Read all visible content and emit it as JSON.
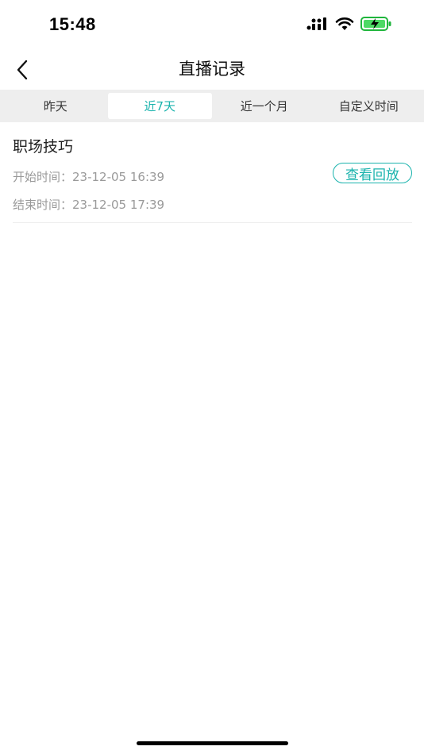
{
  "status_bar": {
    "time": "15:48"
  },
  "nav": {
    "title": "直播记录",
    "back_icon": "chevron-left-icon"
  },
  "tabs": [
    {
      "label": "昨天",
      "active": false
    },
    {
      "label": "近7天",
      "active": true
    },
    {
      "label": "近一个月",
      "active": false
    },
    {
      "label": "自定义时间",
      "active": false
    }
  ],
  "records": [
    {
      "title": "职场技巧",
      "start": "开始时间：23-12-05 16:39",
      "end": "结束时间：23-12-05 17:39",
      "replay_label": "查看回放"
    }
  ],
  "colors": {
    "accent": "#1ab3ad",
    "tab_bg": "#eeeeee",
    "muted_text": "#9a9a9a"
  }
}
